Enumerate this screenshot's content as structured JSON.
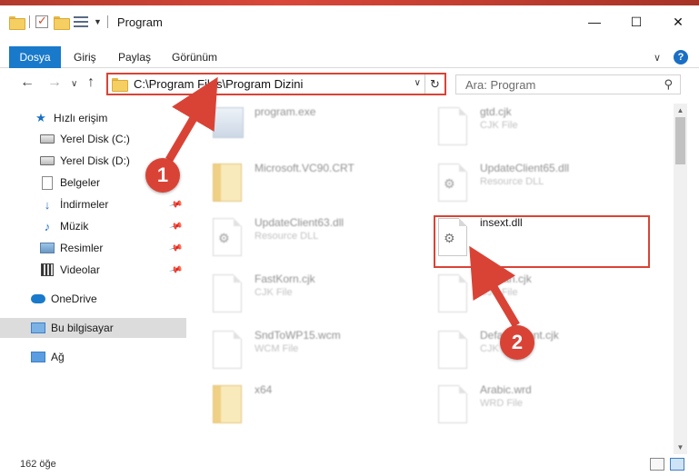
{
  "window": {
    "title": "Program",
    "controls": {
      "minimize": "—",
      "maximize": "☐",
      "close": "✕"
    }
  },
  "ribbon": {
    "tabs": [
      "Dosya",
      "Giriş",
      "Paylaş",
      "Görünüm"
    ],
    "expand_glyph": "∨",
    "help_glyph": "?"
  },
  "address": {
    "path": "C:\\Program Files\\Program Dizini",
    "back": "←",
    "forward": "→",
    "recent": "∨",
    "up": "↑",
    "dropdown": "∨",
    "refresh": "↻"
  },
  "search": {
    "placeholder": "Ara: Program",
    "icon": "search-icon"
  },
  "sidebar": {
    "items": [
      {
        "label": "Hızlı erişim",
        "icon": "star-icon"
      },
      {
        "label": "Yerel Disk (C:)",
        "icon": "drive-icon"
      },
      {
        "label": "Yerel Disk (D:)",
        "icon": "drive-icon"
      },
      {
        "label": "Belgeler",
        "icon": "documents-icon"
      },
      {
        "label": "İndirmeler",
        "icon": "download-icon",
        "pinned": true
      },
      {
        "label": "Müzik",
        "icon": "music-icon",
        "pinned": true
      },
      {
        "label": "Resimler",
        "icon": "pictures-icon",
        "pinned": true
      },
      {
        "label": "Videolar",
        "icon": "video-icon",
        "pinned": true
      },
      {
        "label": "OneDrive",
        "icon": "onedrive-icon"
      },
      {
        "label": "Bu bilgisayar",
        "icon": "computer-icon",
        "selected": true
      },
      {
        "label": "Ağ",
        "icon": "network-icon"
      }
    ]
  },
  "files": [
    {
      "name": "program.exe",
      "type": "",
      "icon": "application-icon"
    },
    {
      "name": "gtd.cjk",
      "type": "CJK File",
      "icon": "file-icon"
    },
    {
      "name": "Microsoft.VC90.CRT",
      "type": "",
      "icon": "folder-icon"
    },
    {
      "name": "UpdateClient65.dll",
      "type": "Resource DLL",
      "icon": "dll-icon"
    },
    {
      "name": "UpdateClient63.dll",
      "type": "Resource DLL",
      "icon": "dll-icon"
    },
    {
      "name": "insext.dll",
      "type": "",
      "icon": "dll-icon",
      "highlighted": true
    },
    {
      "name": "FastKorn.cjk",
      "type": "CJK File",
      "icon": "file-icon"
    },
    {
      "name": "Korean.cjk",
      "type": "CJK File",
      "icon": "file-icon"
    },
    {
      "name": "SndToWP15.wcm",
      "type": "WCM File",
      "icon": "file-icon"
    },
    {
      "name": "DefaultClient.cjk",
      "type": "CJK File",
      "icon": "file-icon"
    },
    {
      "name": "x64",
      "type": "",
      "icon": "folder-icon"
    },
    {
      "name": "Arabic.wrd",
      "type": "WRD File",
      "icon": "file-icon"
    }
  ],
  "annotations": {
    "step1": "1",
    "step2": "2",
    "color": "#d94336"
  },
  "status": {
    "count": "162 öğe"
  }
}
